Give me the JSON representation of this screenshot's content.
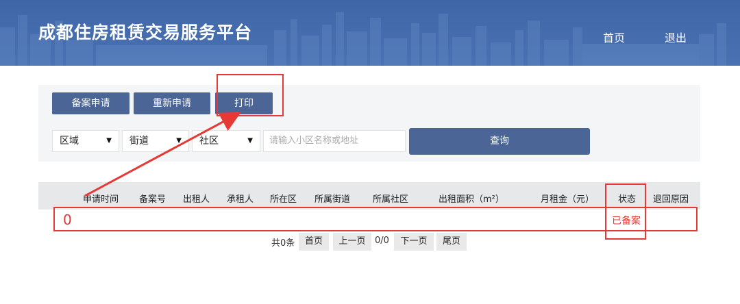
{
  "header": {
    "title": "成都住房租赁交易服务平台",
    "nav": {
      "home": "首页",
      "logout": "退出"
    }
  },
  "toolbar": {
    "filing_apply": "备案申请",
    "reapply": "重新申请",
    "print": "打印"
  },
  "filters": {
    "region": "区域",
    "street": "街道",
    "community": "社区",
    "search_placeholder": "请输入小区名称或地址",
    "query_button": "查询"
  },
  "table": {
    "columns": [
      "申请时间",
      "备案号",
      "出租人",
      "承租人",
      "所在区",
      "所属街道",
      "所属社区",
      "出租面积（m²）",
      "月租金（元）",
      "状态",
      "退回原因"
    ],
    "row": {
      "index": "0",
      "status": "已备案"
    }
  },
  "pagination": {
    "total": "共0条",
    "first": "首页",
    "prev": "上一页",
    "page": "0/0",
    "next": "下一页",
    "last": "尾页"
  },
  "annotations": {
    "color": "#e53935"
  },
  "colors": {
    "header_bg": "#4a72b3",
    "button_bg": "#4a6596"
  }
}
